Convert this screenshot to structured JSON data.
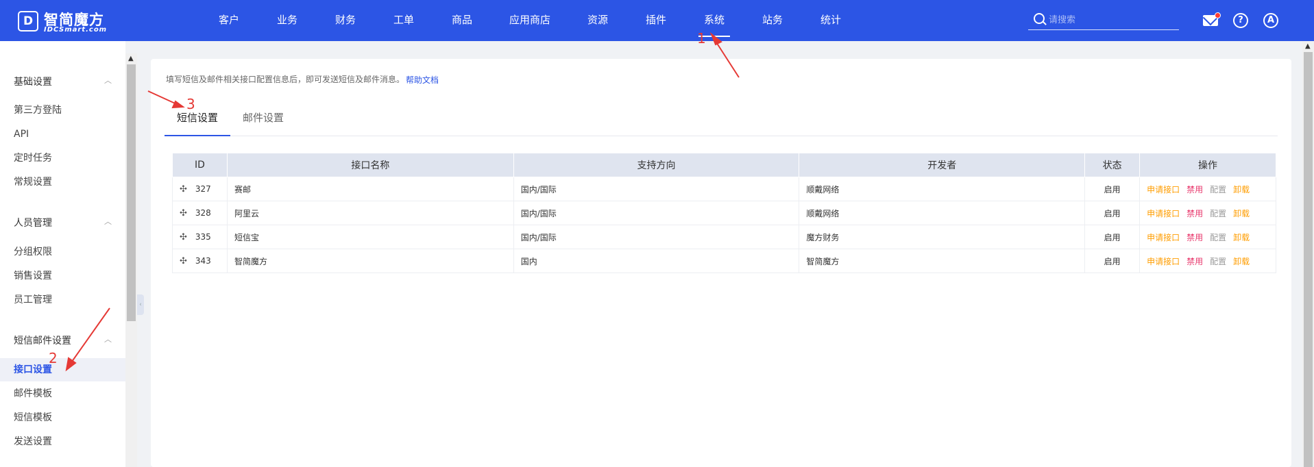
{
  "brand": {
    "badge": "D",
    "name": "智简魔方",
    "sub": "IDCSmart.com"
  },
  "nav": [
    {
      "label": "客户",
      "active": false
    },
    {
      "label": "业务",
      "active": false
    },
    {
      "label": "财务",
      "active": false
    },
    {
      "label": "工单",
      "active": false
    },
    {
      "label": "商品",
      "active": false
    },
    {
      "label": "应用商店",
      "active": false
    },
    {
      "label": "资源",
      "active": false
    },
    {
      "label": "插件",
      "active": false
    },
    {
      "label": "系统",
      "active": true
    },
    {
      "label": "站务",
      "active": false
    },
    {
      "label": "统计",
      "active": false
    }
  ],
  "search": {
    "placeholder": "请搜索"
  },
  "user": {
    "avatar_letter": "A",
    "help_glyph": "?"
  },
  "sidebar": {
    "groups": [
      {
        "title": "基础设置",
        "items": [
          "第三方登陆",
          "API",
          "定时任务",
          "常规设置"
        ]
      },
      {
        "title": "人员管理",
        "items": [
          "分组权限",
          "销售设置",
          "员工管理"
        ]
      },
      {
        "title": "短信邮件设置",
        "items": [
          "接口设置",
          "邮件模板",
          "短信模板",
          "发送设置"
        ]
      }
    ],
    "active_item": "接口设置"
  },
  "main": {
    "hint": "填写短信及邮件相关接口配置信息后，即可发送短信及邮件消息。",
    "help_link": "帮助文档",
    "tabs": [
      {
        "label": "短信设置",
        "active": true
      },
      {
        "label": "邮件设置",
        "active": false
      }
    ],
    "table": {
      "headers": [
        "ID",
        "接口名称",
        "支持方向",
        "开发者",
        "状态",
        "操作"
      ],
      "rows": [
        {
          "id": "327",
          "name": "赛邮",
          "direction": "国内/国际",
          "developer": "顺戴网络",
          "status": "启用"
        },
        {
          "id": "328",
          "name": "阿里云",
          "direction": "国内/国际",
          "developer": "顺戴网络",
          "status": "启用"
        },
        {
          "id": "335",
          "name": "短信宝",
          "direction": "国内/国际",
          "developer": "魔方财务",
          "status": "启用"
        },
        {
          "id": "343",
          "name": "智简魔方",
          "direction": "国内",
          "developer": "智简魔方",
          "status": "启用"
        }
      ],
      "actions": [
        "申请接口",
        "禁用",
        "配置",
        "卸载"
      ]
    }
  },
  "annotations": {
    "n1": "1",
    "n2": "2",
    "n3": "3",
    "color": "#e53935"
  },
  "colors": {
    "primary": "#2c55e5",
    "warning": "#ff9d00",
    "danger": "#e8386c",
    "muted": "#9a9a9a"
  }
}
